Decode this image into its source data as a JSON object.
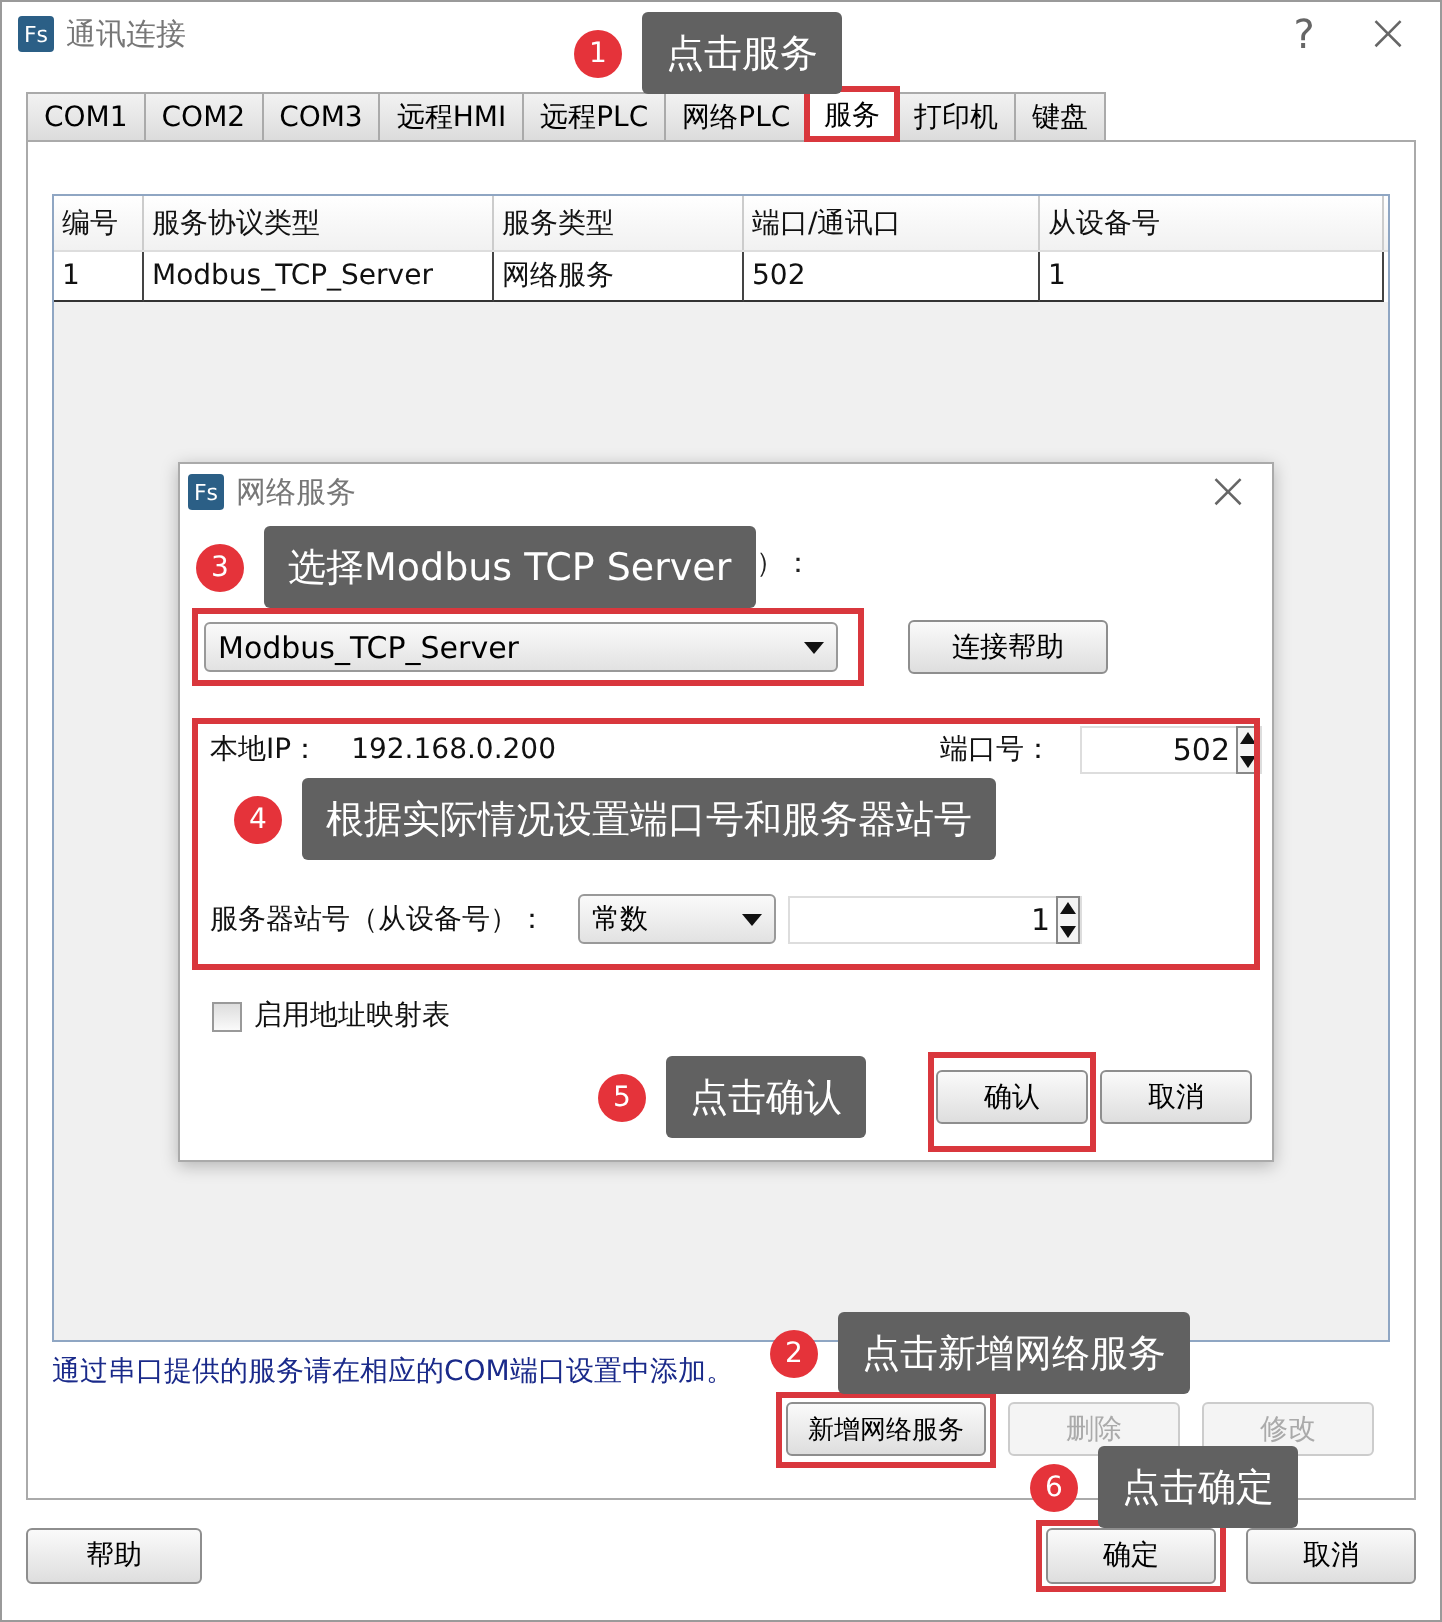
{
  "window": {
    "icon_text": "Fs",
    "title": "通讯连接",
    "help_glyph": "?",
    "close_glyph": "×"
  },
  "tabs": [
    {
      "label": "COM1",
      "selected": false,
      "highlighted": false
    },
    {
      "label": "COM2",
      "selected": false,
      "highlighted": false
    },
    {
      "label": "COM3",
      "selected": false,
      "highlighted": false
    },
    {
      "label": "远程HMI",
      "selected": false,
      "highlighted": false
    },
    {
      "label": "远程PLC",
      "selected": false,
      "highlighted": false
    },
    {
      "label": "网络PLC",
      "selected": false,
      "highlighted": false
    },
    {
      "label": "服务",
      "selected": true,
      "highlighted": true
    },
    {
      "label": "打印机",
      "selected": false,
      "highlighted": false
    },
    {
      "label": "键盘",
      "selected": false,
      "highlighted": false
    }
  ],
  "table": {
    "columns": [
      "编号",
      "服务协议类型",
      "服务类型",
      "端口/通讯口",
      "从设备号"
    ],
    "rows": [
      {
        "cells": [
          "1",
          "Modbus_TCP_Server",
          "网络服务",
          "502",
          "1"
        ]
      }
    ]
  },
  "note": "通过串口提供的服务请在相应的COM端口设置中添加。",
  "list_buttons": [
    {
      "label": "新增网络服务",
      "disabled": false,
      "highlighted": true
    },
    {
      "label": "删除",
      "disabled": true,
      "highlighted": false
    },
    {
      "label": "修改",
      "disabled": true,
      "highlighted": false
    }
  ],
  "footer_buttons": [
    {
      "label": "帮助",
      "highlighted": false
    },
    {
      "label": "确定",
      "highlighted": true
    },
    {
      "label": "取消",
      "highlighted": false
    }
  ],
  "dialog": {
    "icon_text": "Fs",
    "title": "网络服务",
    "close_glyph": "×",
    "label_tail": "）：",
    "protocol": {
      "value": "Modbus_TCP_Server",
      "highlighted": true
    },
    "help_button": "连接帮助",
    "settings_highlighted": true,
    "local_ip_label": "本地IP：",
    "local_ip": "192.168.0.200",
    "port_label": "端口号：",
    "port": "502",
    "station_label": "服务器站号（从设备号）：",
    "station_mode": "常数",
    "station": "1",
    "address_map": {
      "label": "启用地址映射表",
      "checked": false
    },
    "buttons": [
      {
        "label": "确认",
        "highlighted": true
      },
      {
        "label": "取消",
        "highlighted": false
      }
    ]
  },
  "callouts": [
    {
      "number": "1",
      "text": "点击服务"
    },
    {
      "number": "2",
      "text": "点击新增网络服务"
    },
    {
      "number": "3",
      "text": "选择Modbus TCP Server"
    },
    {
      "number": "4",
      "text": "根据实际情况设置端口号和服务器站号"
    },
    {
      "number": "5",
      "text": "点击确认"
    },
    {
      "number": "6",
      "text": "点击确定"
    }
  ]
}
